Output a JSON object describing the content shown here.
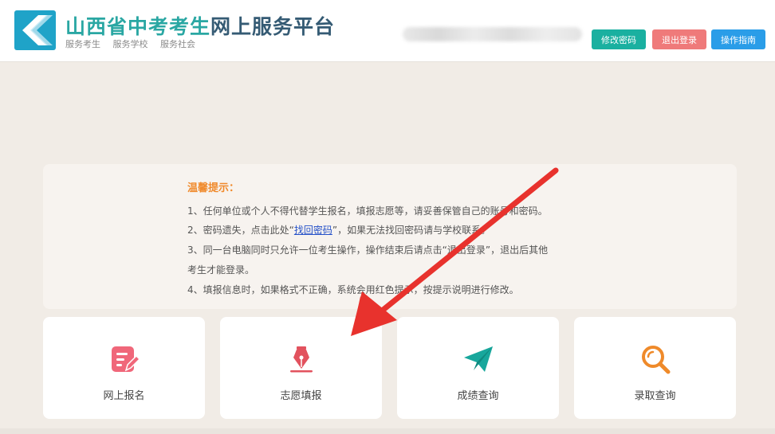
{
  "header": {
    "title_part1": "山西省中考考生",
    "title_part2": "网上服务平台",
    "slogans": [
      "服务考生",
      "服务学校",
      "服务社会"
    ],
    "buttons": {
      "change_password": "修改密码",
      "logout": "退出登录",
      "guide": "操作指南"
    },
    "colors": {
      "title_green": "#2aa7a3",
      "title_dark": "#355b74",
      "pwd": "#1ab0a0",
      "logout": "#ef7a7a",
      "guide": "#2a9de8"
    }
  },
  "notice": {
    "title": "温馨提示：",
    "line1": "1、任何单位或个人不得代替学生报名，填报志愿等，请妥善保管自己的账号和密码。",
    "line2_pre": "2、密码遗失，点击此处“",
    "line2_link": "找回密码",
    "line2_post": "”，如果无法找回密码请与学校联系。",
    "line3": "3、同一台电脑同时只允许一位考生操作，操作结束后请点击“退出登录”，退出后其他",
    "line3b": "考生才能登录。",
    "line4": "4、填报信息时，如果格式不正确，系统会用红色提示，按提示说明进行修改。",
    "colors": {
      "title": "#f08a2c",
      "link": "#2450c8"
    }
  },
  "cards": [
    {
      "label": "网上报名",
      "icon": "edit-form-icon",
      "color": "#f0677a"
    },
    {
      "label": "志愿填报",
      "icon": "pen-nib-icon",
      "color": "#e2525e"
    },
    {
      "label": "成绩查询",
      "icon": "paper-plane-icon",
      "color": "#18a79c"
    },
    {
      "label": "录取查询",
      "icon": "search-icon",
      "color": "#ef8a2a"
    }
  ],
  "annotation": {
    "icon": "red-arrow-icon",
    "color": "#e8322d"
  }
}
